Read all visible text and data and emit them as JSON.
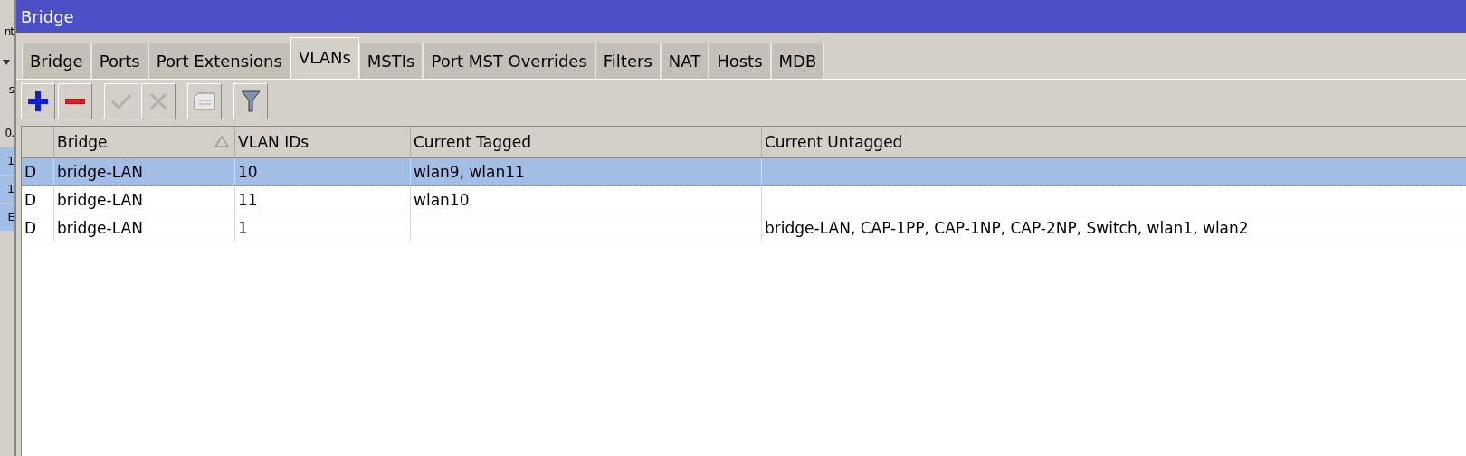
{
  "background_window": {
    "fragments": [
      {
        "text": "nt",
        "kind": "text"
      },
      {
        "kind": "dropdown"
      },
      {
        "text": "s",
        "kind": "text"
      },
      {
        "text": "0.",
        "kind": "header"
      },
      {
        "text": "1",
        "kind": "selected"
      },
      {
        "text": "1",
        "kind": "selected"
      },
      {
        "text": "E",
        "kind": "selected"
      }
    ]
  },
  "window": {
    "title": "Bridge"
  },
  "tabs": [
    {
      "label": "Bridge",
      "selected": false
    },
    {
      "label": "Ports",
      "selected": false
    },
    {
      "label": "Port Extensions",
      "selected": false
    },
    {
      "label": "VLANs",
      "selected": true
    },
    {
      "label": "MSTIs",
      "selected": false
    },
    {
      "label": "Port MST Overrides",
      "selected": false
    },
    {
      "label": "Filters",
      "selected": false
    },
    {
      "label": "NAT",
      "selected": false
    },
    {
      "label": "Hosts",
      "selected": false
    },
    {
      "label": "MDB",
      "selected": false
    }
  ],
  "toolbar": [
    {
      "kind": "add",
      "disabled": false
    },
    {
      "kind": "remove",
      "disabled": false
    },
    {
      "kind": "enable",
      "disabled": true
    },
    {
      "kind": "disable",
      "disabled": true
    },
    {
      "kind": "comment",
      "disabled": false
    },
    {
      "kind": "filter",
      "disabled": false
    }
  ],
  "table": {
    "columns": [
      {
        "sorted": false
      },
      {
        "label": "Bridge",
        "sorted": true
      },
      {
        "label": "VLAN IDs",
        "sorted": false
      },
      {
        "label": "Current Tagged",
        "sorted": false
      },
      {
        "label": "Current Untagged",
        "sorted": false
      }
    ],
    "rows": [
      {
        "selected": true,
        "cells": [
          "D",
          "bridge-LAN",
          "10",
          "wlan9, wlan11",
          ""
        ]
      },
      {
        "selected": false,
        "cells": [
          "D",
          "bridge-LAN",
          "11",
          "wlan10",
          ""
        ]
      },
      {
        "selected": false,
        "cells": [
          "D",
          "bridge-LAN",
          "1",
          "",
          "bridge-LAN, CAP-1PP, CAP-1NP, CAP-2NP, Switch, wlan1, wlan2"
        ]
      }
    ]
  }
}
